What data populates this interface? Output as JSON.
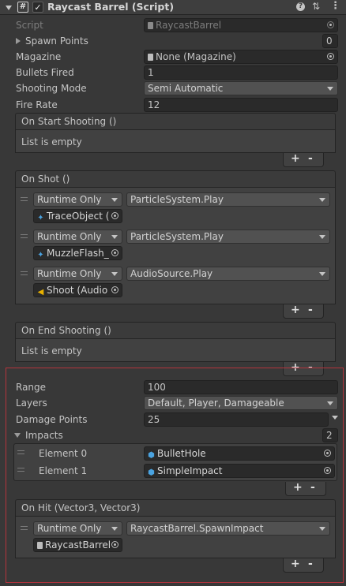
{
  "component": {
    "title": "Raycast Barrel (Script)",
    "enabled": true
  },
  "props": {
    "script_label": "Script",
    "script_value": "RaycastBarrel",
    "spawn_points_label": "Spawn Points",
    "spawn_points_count": "0",
    "magazine_label": "Magazine",
    "magazine_value": "None (Magazine)",
    "bullets_fired_label": "Bullets Fired",
    "bullets_fired_value": "1",
    "shooting_mode_label": "Shooting Mode",
    "shooting_mode_value": "Semi Automatic",
    "fire_rate_label": "Fire Rate",
    "fire_rate_value": "12"
  },
  "events": {
    "on_start": {
      "title": "On Start Shooting ()",
      "empty": "List is empty"
    },
    "on_shot": {
      "title": "On Shot ()",
      "entries": [
        {
          "mode": "Runtime Only",
          "function": "ParticleSystem.Play",
          "target": "TraceObject ("
        },
        {
          "mode": "Runtime Only",
          "function": "ParticleSystem.Play",
          "target": "MuzzleFlash_"
        },
        {
          "mode": "Runtime Only",
          "function": "AudioSource.Play",
          "target": "Shoot (Audio"
        }
      ]
    },
    "on_end": {
      "title": "On End Shooting ()",
      "empty": "List is empty"
    },
    "on_hit": {
      "title": "On Hit (Vector3, Vector3)",
      "entries": [
        {
          "mode": "Runtime Only",
          "function": "RaycastBarrel.SpawnImpact",
          "target": "RaycastBarrel"
        }
      ]
    }
  },
  "raycast": {
    "range_label": "Range",
    "range_value": "100",
    "layers_label": "Layers",
    "layers_value": "Default, Player, Damageable",
    "damage_label": "Damage Points",
    "damage_value": "25",
    "impacts_label": "Impacts",
    "impacts_count": "2",
    "impacts": [
      {
        "label": "Element 0",
        "value": "BulletHole"
      },
      {
        "label": "Element 1",
        "value": "SimpleImpact"
      }
    ]
  },
  "buttons": {
    "plus": "+",
    "minus": "-"
  },
  "icons": {
    "script": "script-hash-icon",
    "cube": "prefab-cube-icon",
    "audio": "audio-source-icon",
    "particle": "particle-system-icon"
  },
  "colors": {
    "selection_outline": "#b5333d",
    "background": "#383838"
  }
}
